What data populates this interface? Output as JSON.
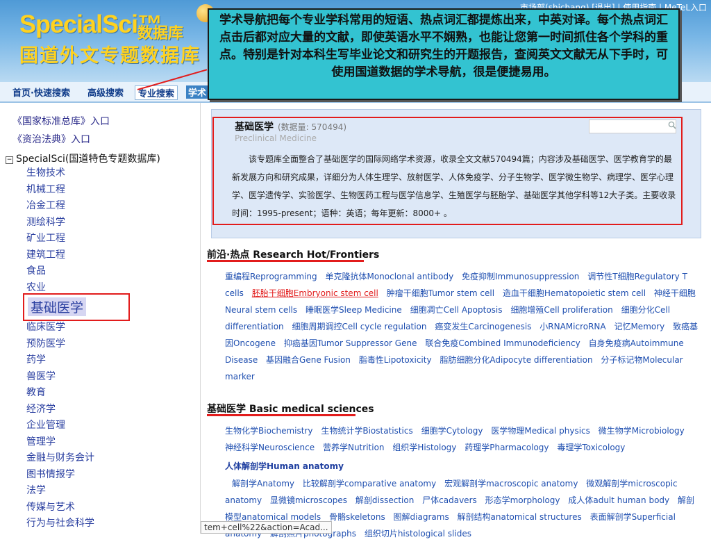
{
  "header": {
    "logo_en": "SpecialSci™",
    "logo_cn_small": "数据库",
    "logo_cn_big": "国道外文专题数据库",
    "toplinks": "市场部(shichang) [退出] | 使用指南 | MeTeL入口"
  },
  "nav": {
    "home": "首页·快速搜索",
    "advanced": "高级搜索",
    "pro": "专业搜索",
    "cut": "学术"
  },
  "callout": "学术导航把每个专业学科常用的短语、热点词汇都提炼出来，中英对译。每个热点词汇点击后都对应大量的文献，即使英语水平不娴熟，也能让您第一时间抓住各个学科的重点。特别是针对本科生写毕业论文和研究生的开题报告，查阅英文文献无从下手时，可使用国道数据的学术导航，很是便捷易用。",
  "sidebar": {
    "links": [
      "《国家标准总库》入口",
      "《资治法典》入口"
    ],
    "tree_root": "SpecialSci(国道特色专题数据库)",
    "tree_box": "−",
    "cats_top": [
      "生物技术",
      "机械工程",
      "冶金工程",
      "测绘科学",
      "矿业工程",
      "建筑工程",
      "食品",
      "农业"
    ],
    "selected": "基础医学",
    "cats_bottom": [
      "临床医学",
      "预防医学",
      "药学",
      "兽医学",
      "教育",
      "经济学",
      "企业管理",
      "管理学",
      "金融与财务会计",
      "图书情报学",
      "法学",
      "传媒与艺术",
      "行为与社会科学"
    ]
  },
  "db": {
    "title": "基础医学",
    "count": "(数据量: 570494)",
    "en": "Preclinical Medicine",
    "desc": "该专题库全面整合了基础医学的国际网络学术资源，收录全文文献570494篇；内容涉及基础医学、医学教育学的最新发展方向和研究成果，详细分为人体生理学、放射医学、人体免疫学、分子生物学、医学微生物学、病理学、医学心理学、医学遗传学、实验医学、生物医药工程与医学信息学、生殖医学与胚胎学、基础医学其他学科等12大子类。主要收录时间：1995-present；语种：英语；每年更新：8000+ 。"
  },
  "hot": {
    "title": "前沿·热点 Research Hot/Frontiers",
    "items": [
      "重编程Reprogramming",
      "单克隆抗体Monoclonal antibody",
      "免疫抑制Immunosuppression",
      "调节性T细胞Regulatory T cells",
      "胚胎干细胞Embryonic stem cell",
      "肿瘤干细胞Tumor stem cell",
      "造血干细胞Hematopoietic stem cell",
      "神经干细胞Neural stem cells",
      "睡眠医学Sleep Medicine",
      "细胞凋亡Cell Apoptosis",
      "细胞增殖Cell proliferation",
      "细胞分化Cell differentiation",
      "细胞周期调控Cell cycle regulation",
      "癌变发生Carcinogenesis",
      "小RNAMicroRNA",
      "记忆Memory",
      "致癌基因Oncogene",
      "抑癌基因Tumor Suppressor Gene",
      "联合免疫Combined Immunodeficiency",
      "自身免疫病Autoimmune Disease",
      "基因融合Gene Fusion",
      "脂毒性Lipotoxicity",
      "脂肪细胞分化Adipocyte differentiation",
      "分子标记物Molecular marker"
    ],
    "highlight_index": 4
  },
  "basic": {
    "title": "基础医学 Basic medical sciences",
    "items": [
      "生物化学Biochemistry",
      "生物统计学Biostatistics",
      "细胞学Cytology",
      "医学物理Medical physics",
      "微生物学Microbiology",
      "神经科学Neuroscience",
      "营养学Nutrition",
      "组织学Histology",
      "药理学Pharmacology",
      "毒理学Toxicology"
    ],
    "subheader": "人体解剖学Human anatomy",
    "anatomy": [
      "解剖学Anatomy",
      "比较解剖学comparative anatomy",
      "宏观解剖学macroscopic anatomy",
      "微观解剖学microscopic anatomy",
      "显微镜microscopes",
      "解剖dissection",
      "尸体cadavers",
      "形态学morphology",
      "成人体adult human body",
      "解剖模型anatomical models",
      "骨骼skeletons",
      "图解diagrams",
      "解剖结构anatomical structures",
      "表面解剖学Superficial anatomy",
      "解剖照片photographs",
      "组织切片histological slides"
    ]
  },
  "status": "tem+cell%22&action=Acad..."
}
